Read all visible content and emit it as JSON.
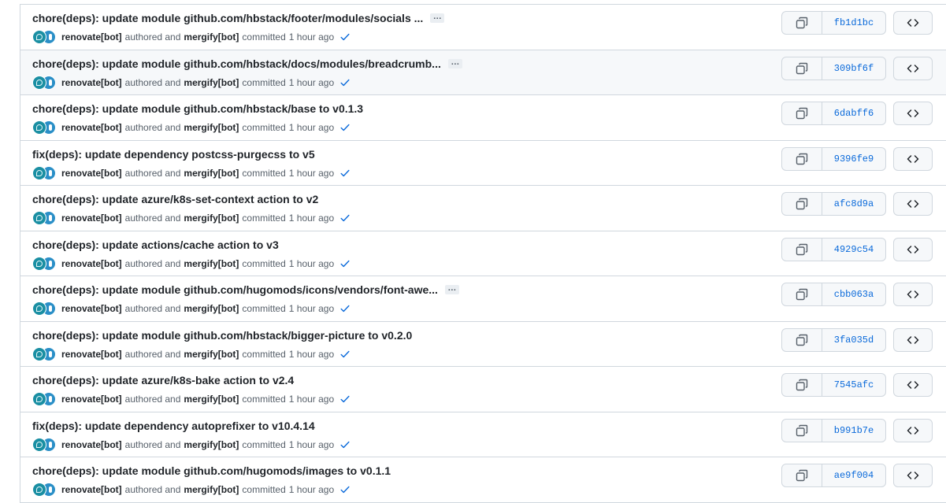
{
  "commits": [
    {
      "title": "chore(deps): update module github.com/hbstack/footer/modules/socials ...",
      "has_more": true,
      "author": "renovate[bot]",
      "authored_text": "authored and",
      "committer": "mergify[bot]",
      "committed_text": "committed",
      "time": "1 hour ago",
      "sha": "fb1d1bc"
    },
    {
      "title": "chore(deps): update module github.com/hbstack/docs/modules/breadcrumb...",
      "has_more": true,
      "author": "renovate[bot]",
      "authored_text": "authored and",
      "committer": "mergify[bot]",
      "committed_text": "committed",
      "time": "1 hour ago",
      "sha": "309bf6f"
    },
    {
      "title": "chore(deps): update module github.com/hbstack/base to v0.1.3",
      "has_more": false,
      "author": "renovate[bot]",
      "authored_text": "authored and",
      "committer": "mergify[bot]",
      "committed_text": "committed",
      "time": "1 hour ago",
      "sha": "6dabff6"
    },
    {
      "title": "fix(deps): update dependency postcss-purgecss to v5",
      "has_more": false,
      "author": "renovate[bot]",
      "authored_text": "authored and",
      "committer": "mergify[bot]",
      "committed_text": "committed",
      "time": "1 hour ago",
      "sha": "9396fe9"
    },
    {
      "title": "chore(deps): update azure/k8s-set-context action to v2",
      "has_more": false,
      "author": "renovate[bot]",
      "authored_text": "authored and",
      "committer": "mergify[bot]",
      "committed_text": "committed",
      "time": "1 hour ago",
      "sha": "afc8d9a"
    },
    {
      "title": "chore(deps): update actions/cache action to v3",
      "has_more": false,
      "author": "renovate[bot]",
      "authored_text": "authored and",
      "committer": "mergify[bot]",
      "committed_text": "committed",
      "time": "1 hour ago",
      "sha": "4929c54"
    },
    {
      "title": "chore(deps): update module github.com/hugomods/icons/vendors/font-awe...",
      "has_more": true,
      "author": "renovate[bot]",
      "authored_text": "authored and",
      "committer": "mergify[bot]",
      "committed_text": "committed",
      "time": "1 hour ago",
      "sha": "cbb063a"
    },
    {
      "title": "chore(deps): update module github.com/hbstack/bigger-picture to v0.2.0",
      "has_more": false,
      "author": "renovate[bot]",
      "authored_text": "authored and",
      "committer": "mergify[bot]",
      "committed_text": "committed",
      "time": "1 hour ago",
      "sha": "3fa035d"
    },
    {
      "title": "chore(deps): update azure/k8s-bake action to v2.4",
      "has_more": false,
      "author": "renovate[bot]",
      "authored_text": "authored and",
      "committer": "mergify[bot]",
      "committed_text": "committed",
      "time": "1 hour ago",
      "sha": "7545afc"
    },
    {
      "title": "fix(deps): update dependency autoprefixer to v10.4.14",
      "has_more": false,
      "author": "renovate[bot]",
      "authored_text": "authored and",
      "committer": "mergify[bot]",
      "committed_text": "committed",
      "time": "1 hour ago",
      "sha": "b991b7e"
    },
    {
      "title": "chore(deps): update module github.com/hugomods/images to v0.1.1",
      "has_more": false,
      "author": "renovate[bot]",
      "authored_text": "authored and",
      "committer": "mergify[bot]",
      "committed_text": "committed",
      "time": "1 hour ago",
      "sha": "ae9f004"
    }
  ],
  "ellipsis_label": "…",
  "highlighted_index": 1,
  "colors": {
    "link": "#0969da",
    "check": "#0969da",
    "border": "#d0d7de",
    "row_hover": "#f6f8fa",
    "avatar_renovate": "#1a8fa3",
    "avatar_mergify": "#2a8fc7"
  },
  "icons": {
    "copy": "copy-icon",
    "check": "check-icon",
    "browse": "code-icon"
  }
}
